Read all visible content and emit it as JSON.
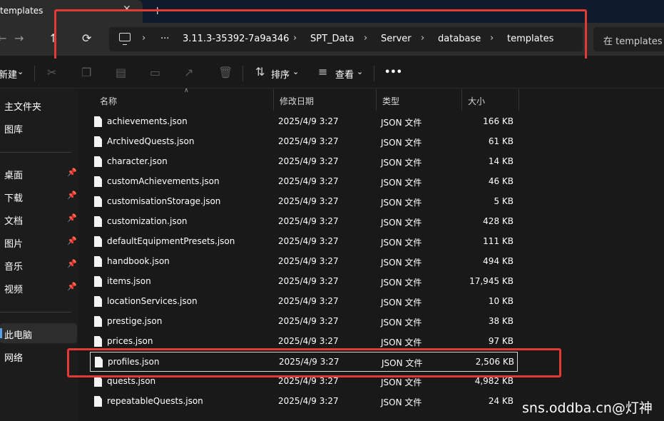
{
  "window": {
    "tab_title": "templates",
    "tab_close": "✕",
    "new_tab": "+"
  },
  "nav": {
    "back": "←",
    "forward": "→",
    "up": "↑",
    "refresh": "⟳",
    "chevron": "›",
    "more": "···",
    "breadcrumbs": [
      "3.11.3-35392-7a9a346",
      "SPT_Data",
      "Server",
      "database",
      "templates"
    ],
    "search_placeholder": "在 templates 中搜索"
  },
  "toolbar": {
    "new_label": "新建",
    "new_chevron": "⌄",
    "sort_label": "排序",
    "view_label": "查看",
    "more_label": "•••"
  },
  "sidebar": {
    "items": [
      {
        "label": "主文件夹",
        "pinned": false
      },
      {
        "label": "图库",
        "pinned": false
      },
      {
        "label": "桌面",
        "pinned": true
      },
      {
        "label": "下载",
        "pinned": true
      },
      {
        "label": "文档",
        "pinned": true
      },
      {
        "label": "图片",
        "pinned": true
      },
      {
        "label": "音乐",
        "pinned": true
      },
      {
        "label": "视频",
        "pinned": true
      },
      {
        "label": "此电脑",
        "pinned": false,
        "selected": true
      },
      {
        "label": "网络",
        "pinned": false
      }
    ]
  },
  "columns": {
    "name": "名称",
    "date": "修改日期",
    "type": "类型",
    "size": "大小"
  },
  "files": [
    {
      "name": "achievements.json",
      "date": "2025/4/9 3:27",
      "type": "JSON 文件",
      "size": "166 KB"
    },
    {
      "name": "ArchivedQuests.json",
      "date": "2025/4/9 3:27",
      "type": "JSON 文件",
      "size": "61 KB"
    },
    {
      "name": "character.json",
      "date": "2025/4/9 3:27",
      "type": "JSON 文件",
      "size": "14 KB"
    },
    {
      "name": "customAchievements.json",
      "date": "2025/4/9 3:27",
      "type": "JSON 文件",
      "size": "46 KB"
    },
    {
      "name": "customisationStorage.json",
      "date": "2025/4/9 3:27",
      "type": "JSON 文件",
      "size": "5 KB"
    },
    {
      "name": "customization.json",
      "date": "2025/4/9 3:27",
      "type": "JSON 文件",
      "size": "428 KB"
    },
    {
      "name": "defaultEquipmentPresets.json",
      "date": "2025/4/9 3:27",
      "type": "JSON 文件",
      "size": "111 KB"
    },
    {
      "name": "handbook.json",
      "date": "2025/4/9 3:27",
      "type": "JSON 文件",
      "size": "494 KB"
    },
    {
      "name": "items.json",
      "date": "2025/4/9 3:27",
      "type": "JSON 文件",
      "size": "17,945 KB"
    },
    {
      "name": "locationServices.json",
      "date": "2025/4/9 3:27",
      "type": "JSON 文件",
      "size": "10 KB"
    },
    {
      "name": "prestige.json",
      "date": "2025/4/9 3:27",
      "type": "JSON 文件",
      "size": "38 KB"
    },
    {
      "name": "prices.json",
      "date": "2025/4/9 3:27",
      "type": "JSON 文件",
      "size": "97 KB"
    },
    {
      "name": "profiles.json",
      "date": "2025/4/9 3:27",
      "type": "JSON 文件",
      "size": "2,506 KB",
      "selected": true
    },
    {
      "name": "quests.json",
      "date": "2025/4/9 3:27",
      "type": "JSON 文件",
      "size": "4,982 KB"
    },
    {
      "name": "repeatableQuests.json",
      "date": "2025/4/9 3:27",
      "type": "JSON 文件",
      "size": "24 KB"
    }
  ],
  "watermark": "sns.oddba.cn@灯神",
  "colors": {
    "highlight": "#e53935",
    "background": "#191919",
    "accent": "#5aa0e6"
  }
}
